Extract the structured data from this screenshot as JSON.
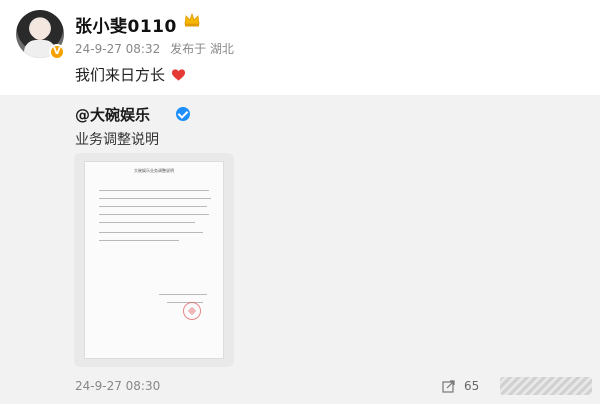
{
  "post": {
    "username": "张小斐0110",
    "date": "24-9-27 08:32",
    "source": "发布于 湖北",
    "text": "我们来日方长",
    "badge": "V",
    "icons": {
      "crown": "crown-icon",
      "heart": "heart-icon"
    }
  },
  "repost": {
    "author": "@大碗娱乐",
    "text": "业务调整说明",
    "document": {
      "title": "大碗娱乐业务调整说明",
      "seal": "seal-icon"
    },
    "time": "24-9-27 08:30",
    "share_count": "65",
    "icons": {
      "verified": "verify-icon",
      "share": "share-icon"
    }
  },
  "colors": {
    "accent_orange": "#f7a100",
    "verify_blue": "#1d8fff",
    "heart_red": "#e53935",
    "repost_bg": "#f2f2f2"
  }
}
